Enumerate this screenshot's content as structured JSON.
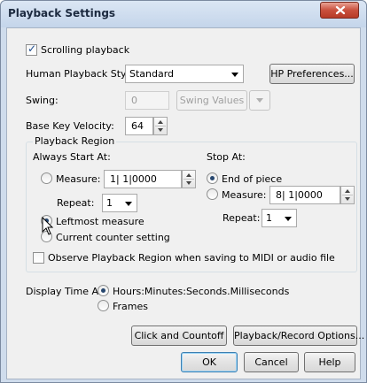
{
  "window": {
    "title": "Playback Settings"
  },
  "scrolling_playback": {
    "label": "Scrolling playback",
    "checked": true
  },
  "human_playback": {
    "label": "Human Playback Style:",
    "value": "Standard",
    "button": "HP Preferences..."
  },
  "swing": {
    "label": "Swing:",
    "value": "0",
    "values_label": "Swing Values"
  },
  "velocity": {
    "label": "Base Key Velocity:",
    "value": "64"
  },
  "region": {
    "title": "Playback Region",
    "start_label": "Always Start At:",
    "stop_label": "Stop At:",
    "start_measure_label": "Measure:",
    "start_measure_value": "1| 1|0000",
    "repeat_label": "Repeat:",
    "start_repeat_value": "1",
    "leftmost_label": "Leftmost measure",
    "counter_label": "Current counter setting",
    "end_label": "End of piece",
    "stop_measure_label": "Measure:",
    "stop_measure_value": "8| 1|0000",
    "stop_repeat_value": "1",
    "start_selected": "leftmost",
    "stop_selected": "end"
  },
  "observe": {
    "label": "Observe Playback Region when saving to MIDI or audio file",
    "checked": false
  },
  "display_time": {
    "label": "Display Time As:",
    "option1": "Hours:Minutes:Seconds.Milliseconds",
    "option2": "Frames",
    "selected": "hms"
  },
  "buttons": {
    "click": "Click and Countoff",
    "playback_record": "Playback/Record Options...",
    "ok": "OK",
    "cancel": "Cancel",
    "help": "Help"
  }
}
